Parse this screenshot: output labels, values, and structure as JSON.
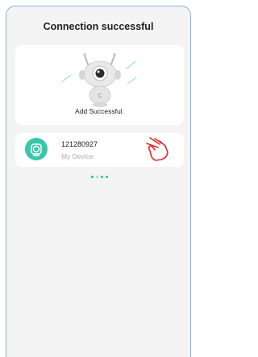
{
  "header": {
    "title": "Connection successful"
  },
  "status": {
    "message": "Add Successful."
  },
  "device": {
    "id": "121280927",
    "name": "My Device",
    "avatar_icon": "dome-camera-icon",
    "pointer_icon": "tap-hand-icon"
  },
  "pager": {
    "dots": 4,
    "active_index": 0
  },
  "colors": {
    "accent": "#2ec4a0",
    "frame_border": "#7fb7d7",
    "background": "#f4f4f4"
  }
}
